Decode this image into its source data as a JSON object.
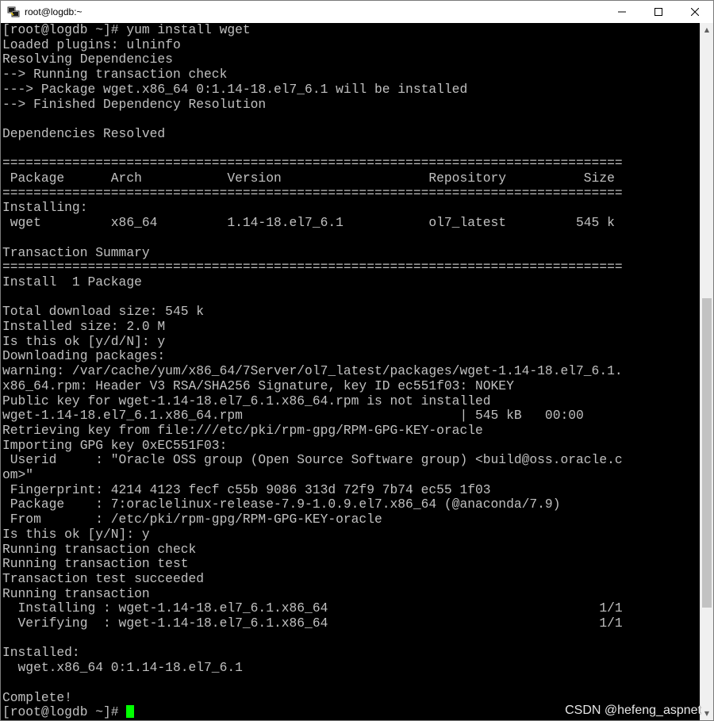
{
  "window": {
    "title": "root@logdb:~",
    "icon": "putty-terminal-icon",
    "controls": {
      "minimize": "—",
      "maximize": "☐",
      "close": "✕"
    }
  },
  "terminal": {
    "colors": {
      "foreground": "#c0c0c0",
      "background": "#000000",
      "cursor": "#00ff00"
    },
    "lines": [
      "[root@logdb ~]# yum install wget",
      "Loaded plugins: ulninfo",
      "Resolving Dependencies",
      "--> Running transaction check",
      "---> Package wget.x86_64 0:1.14-18.el7_6.1 will be installed",
      "--> Finished Dependency Resolution",
      "",
      "Dependencies Resolved",
      "",
      "================================================================================",
      " Package      Arch           Version                   Repository          Size",
      "================================================================================",
      "Installing:",
      " wget         x86_64         1.14-18.el7_6.1           ol7_latest         545 k",
      "",
      "Transaction Summary",
      "================================================================================",
      "Install  1 Package",
      "",
      "Total download size: 545 k",
      "Installed size: 2.0 M",
      "Is this ok [y/d/N]: y",
      "Downloading packages:",
      "warning: /var/cache/yum/x86_64/7Server/ol7_latest/packages/wget-1.14-18.el7_6.1.",
      "x86_64.rpm: Header V3 RSA/SHA256 Signature, key ID ec551f03: NOKEY",
      "Public key for wget-1.14-18.el7_6.1.x86_64.rpm is not installed",
      "wget-1.14-18.el7_6.1.x86_64.rpm                            | 545 kB   00:00",
      "Retrieving key from file:///etc/pki/rpm-gpg/RPM-GPG-KEY-oracle",
      "Importing GPG key 0xEC551F03:",
      " Userid     : \"Oracle OSS group (Open Source Software group) <build@oss.oracle.c",
      "om>\"",
      " Fingerprint: 4214 4123 fecf c55b 9086 313d 72f9 7b74 ec55 1f03",
      " Package    : 7:oraclelinux-release-7.9-1.0.9.el7.x86_64 (@anaconda/7.9)",
      " From       : /etc/pki/rpm-gpg/RPM-GPG-KEY-oracle",
      "Is this ok [y/N]: y",
      "Running transaction check",
      "Running transaction test",
      "Transaction test succeeded",
      "Running transaction",
      "  Installing : wget-1.14-18.el7_6.1.x86_64                                   1/1",
      "  Verifying  : wget-1.14-18.el7_6.1.x86_64                                   1/1",
      "",
      "Installed:",
      "  wget.x86_64 0:1.14-18.el7_6.1",
      "",
      "Complete!"
    ],
    "prompt": "[root@logdb ~]# "
  },
  "scrollbar": {
    "up_arrow": "▲",
    "down_arrow": "▼",
    "thumb_position": 0.55
  },
  "watermark": "CSDN @hefeng_aspnet"
}
